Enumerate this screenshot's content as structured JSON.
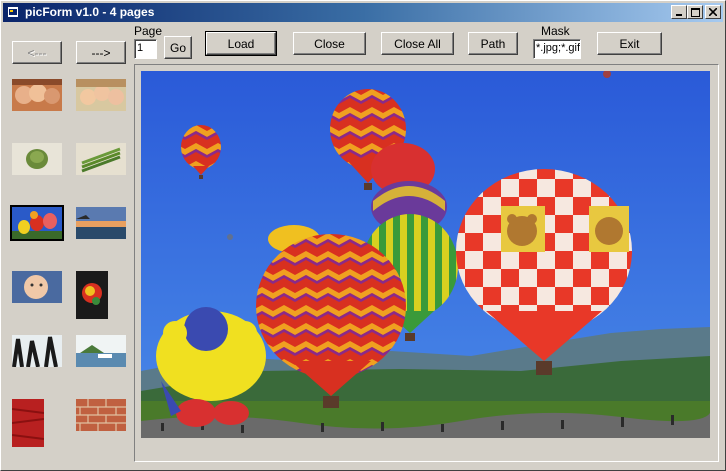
{
  "window": {
    "title": "picForm v1.0 - 4 pages"
  },
  "nav": {
    "prev_label": "<---",
    "next_label": "--->"
  },
  "page": {
    "label": "Page",
    "value": "1",
    "go_label": "Go"
  },
  "toolbar": {
    "load_label": "Load",
    "close_label": "Close",
    "close_all_label": "Close All",
    "path_label": "Path",
    "exit_label": "Exit"
  },
  "mask": {
    "label": "Mask",
    "value": "*.jpg;*.gif"
  },
  "thumbnails": [
    {
      "name": "thumb-children-faces"
    },
    {
      "name": "thumb-three-kids"
    },
    {
      "name": "thumb-artichoke"
    },
    {
      "name": "thumb-asparagus"
    },
    {
      "name": "thumb-hot-air-balloons",
      "selected": true
    },
    {
      "name": "thumb-beach-sunset"
    },
    {
      "name": "thumb-baby-face"
    },
    {
      "name": "thumb-fantasy-art"
    },
    {
      "name": "thumb-tree-silhouette"
    },
    {
      "name": "thumb-boat-lake"
    },
    {
      "name": "thumb-red-texture"
    },
    {
      "name": "thumb-brick-wall"
    }
  ],
  "viewer": {
    "image": "hot-air-balloons-festival"
  }
}
